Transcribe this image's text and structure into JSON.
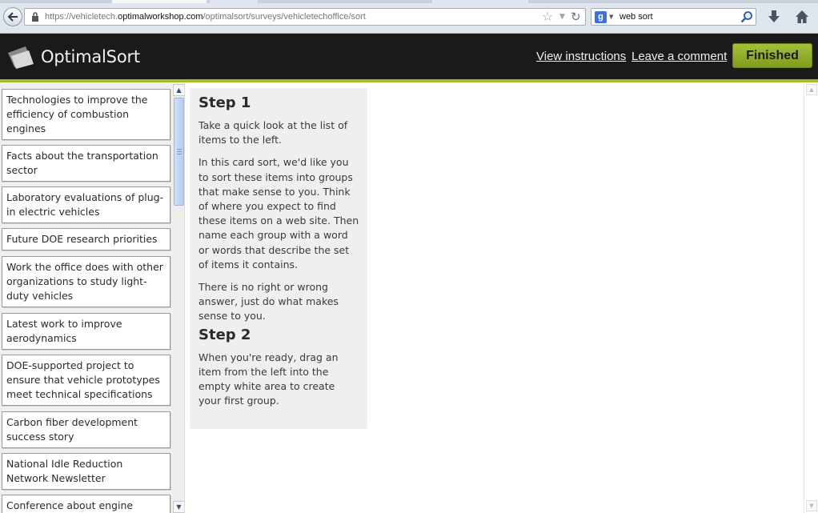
{
  "browser": {
    "url_prefix": "https://vehicletech.",
    "url_domain": "optimalworkshop.com",
    "url_suffix": "/optimalsort/surveys/vehicletechoffice/sort",
    "search_value": "web sort"
  },
  "header": {
    "logo_text": "OptimalSort",
    "view_instructions": "View instructions",
    "leave_comment": "Leave a comment",
    "finished": "Finished"
  },
  "cards": [
    "Technologies to improve the efficiency of combustion engines",
    "Facts about the transportation sector",
    "Laboratory evaluations of plug-in electric vehicles",
    "Future DOE research priorities",
    "Work the office does with other organizations to study light-duty vehicles",
    "Latest work to improve aerodynamics",
    "DOE-supported project to ensure that vehicle prototypes meet technical specifications",
    "Carbon fiber development success story",
    "National Idle Reduction Network Newsletter",
    "Conference about engine"
  ],
  "instructions": {
    "step1_title": "Step 1",
    "step1_p1": "Take a quick look at the list of items to the left.",
    "step1_p2": "In this card sort, we'd like you to sort these items into groups that make sense to you. Think of where you expect to find these items on a web site. Then name each group with a word or words that describe the set of items it contains.",
    "step1_p3": "There is no right or wrong answer, just do what makes sense to you.",
    "step2_title": "Step 2",
    "step2_p1": "When you're ready, drag an item from the left into the empty white area to create your first group."
  },
  "colors": {
    "header_bg": "#1a1a1a",
    "accent_green": "#9ebd2f",
    "finished_button": "#8fae2c"
  }
}
